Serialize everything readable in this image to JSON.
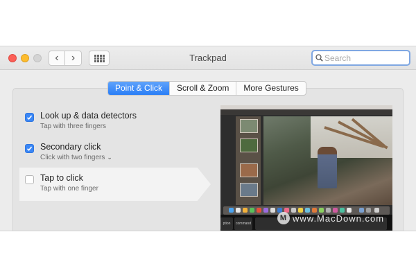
{
  "window": {
    "title": "Trackpad",
    "search": {
      "placeholder": "Search"
    },
    "nav": {
      "back": "‹",
      "forward": "›"
    }
  },
  "tabs": [
    {
      "label": "Point & Click",
      "active": true
    },
    {
      "label": "Scroll & Zoom",
      "active": false
    },
    {
      "label": "More Gestures",
      "active": false
    }
  ],
  "options": [
    {
      "label": "Look up & data detectors",
      "sub": "Tap with three fingers",
      "checked": true
    },
    {
      "label": "Secondary click",
      "sub": "Click with two fingers",
      "checked": true
    },
    {
      "label": "Tap to click",
      "sub": "Tap with one finger",
      "checked": false
    }
  ],
  "preview": {
    "touchbar_keys": [
      "ption",
      "command"
    ]
  },
  "watermark": {
    "text": "www.MacDown.com",
    "logo": "M"
  },
  "colors": {
    "accent": "#2a7ef6",
    "close": "#fc5f57",
    "minimize": "#fdbc2e"
  }
}
